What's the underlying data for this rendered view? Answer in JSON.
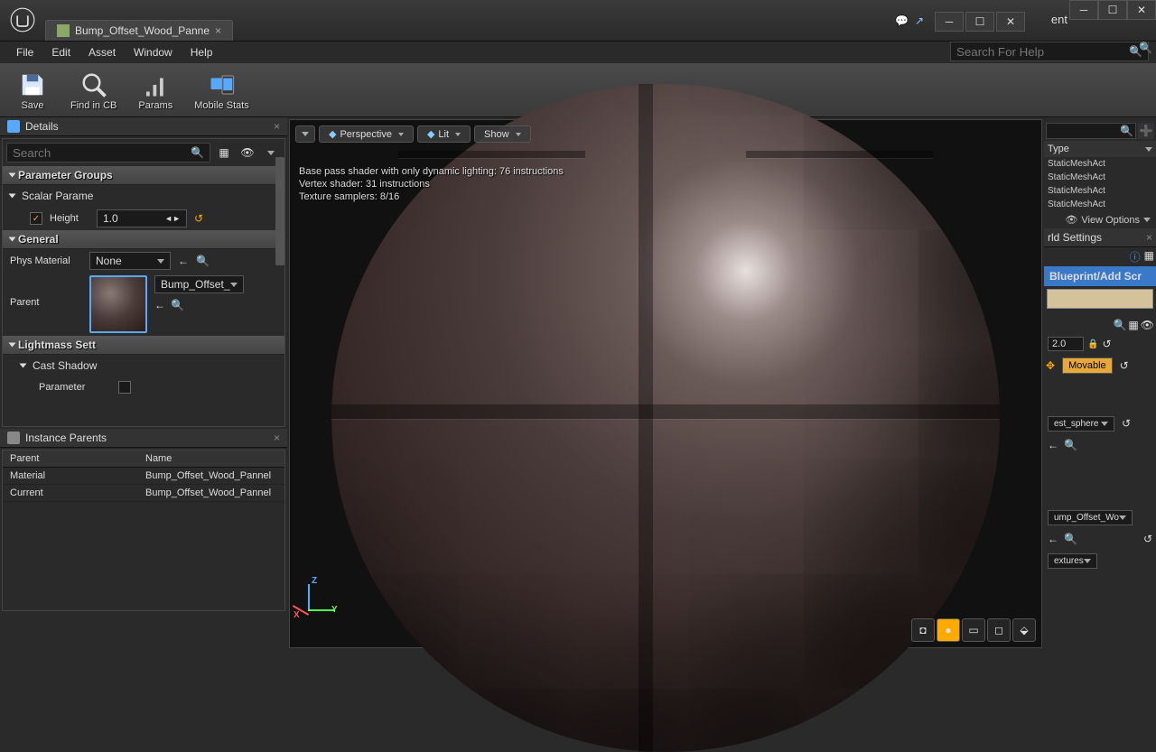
{
  "tab_title": "Bump_Offset_Wood_Panne",
  "menus": {
    "file": "File",
    "edit": "Edit",
    "asset": "Asset",
    "window": "Window",
    "help": "Help"
  },
  "search_help_placeholder": "Search For Help",
  "toolbar": {
    "save": "Save",
    "find_in_cb": "Find in CB",
    "params": "Params",
    "mobile_stats": "Mobile Stats"
  },
  "details": {
    "panel_title": "Details",
    "search_placeholder": "Search",
    "parameter_groups": "Parameter Groups",
    "scalar_params": "Scalar Parame",
    "height_label": "Height",
    "height_value": "1.0",
    "general": "General",
    "phys_material_label": "Phys Material",
    "phys_material_value": "None",
    "parent_label": "Parent",
    "parent_value": "Bump_Offset_",
    "lightmass": "Lightmass Sett",
    "cast_shadow": "Cast Shadow",
    "parameter_label": "Parameter"
  },
  "instance_parents": {
    "panel_title": "Instance Parents",
    "col_parent": "Parent",
    "col_name": "Name",
    "rows": [
      {
        "parent": "Material",
        "name": "Bump_Offset_Wood_Pannel"
      },
      {
        "parent": "Current",
        "name": "Bump_Offset_Wood_Pannel"
      }
    ]
  },
  "viewport": {
    "menu": "☰",
    "perspective": "Perspective",
    "lit": "Lit",
    "show": "Show",
    "stats_1": "Base pass shader with only dynamic lighting: 76 instructions",
    "stats_2": "Vertex shader: 31 instructions",
    "stats_3": "Texture samplers: 8/16",
    "axis_x": "X",
    "axis_y": "Y",
    "axis_z": "Z"
  },
  "right": {
    "col_type": "Type",
    "static_mesh": "StaticMeshAct",
    "view_options": "View Options",
    "world_settings": "rld Settings",
    "blueprint": "Blueprint/Add Scr",
    "transform_value": "2.0",
    "movable": "Movable",
    "est_sphere": "est_sphere",
    "material_name": "ump_Offset_Wo",
    "textures": "extures"
  },
  "outer_title": "ent"
}
